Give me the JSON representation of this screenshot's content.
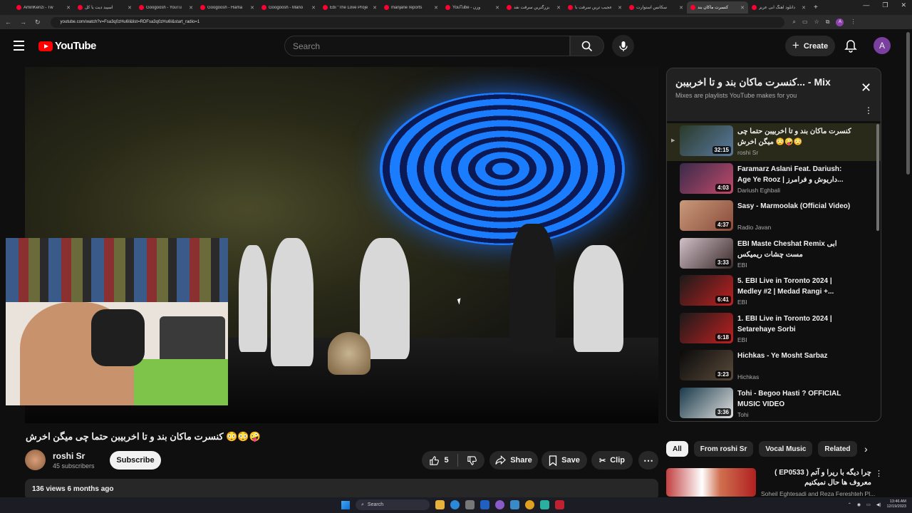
{
  "browser": {
    "tabs": [
      {
        "label": "AminKenzi - Tw"
      },
      {
        "label": "اسپید دیت یا کل"
      },
      {
        "label": "Googoosh - YouTu"
      },
      {
        "label": "Googoosh - Hama"
      },
      {
        "label": "Googoosh - Mano"
      },
      {
        "label": "Ebi \"The Love Proje"
      },
      {
        "label": "manjane reports"
      },
      {
        "label": "YouTube - وزن"
      },
      {
        "label": "بزرگترین سرقت نقد"
      },
      {
        "label": "عجیب ترین سرقت با"
      },
      {
        "label": "سکانس استوارت"
      },
      {
        "label": "کنسرت ماکان بند"
      },
      {
        "label": "دانلود آهنگ ابی عزیز"
      }
    ],
    "url": "youtube.com/watch?v=Fsa3q0zHu6I&list=RDFsa3q0zHu6I&start_radio=1",
    "avatar_letter": "A"
  },
  "header": {
    "logo_text": "YouTube",
    "search_placeholder": "Search",
    "create_label": "Create",
    "avatar_letter": "A"
  },
  "video": {
    "title": "کنسرت ماکان بند و تا اخربیبن حتما چی میگن اخرش 😳😳🤪",
    "channel": "roshi Sr",
    "subscribers": "45 subscribers",
    "subscribe_label": "Subscribe",
    "likes": "5",
    "share_label": "Share",
    "save_label": "Save",
    "clip_label": "Clip",
    "stats": "136 views  6 months ago"
  },
  "playlist": {
    "title": "کنسرت ماکان بند و تا اخربیبن... - Mix",
    "subtitle": "Mixes are playlists YouTube makes for you",
    "items": [
      {
        "index": "▶",
        "title": "کنسرت ماکان بند و تا اخربیبن حتما چی میگن اخرش 😳🤪😳",
        "channel": "roshi Sr",
        "duration": "32:15",
        "c1": "#2a3a2a",
        "c2": "#5a7aa0"
      },
      {
        "index": "",
        "title": "Faramarz Aslani Feat. Dariush: Age Ye Rooz | داریوش و فرامرز...",
        "channel": "Dariush Eghbali",
        "duration": "4:03",
        "c1": "#3a2a4a",
        "c2": "#c04a6a"
      },
      {
        "index": "",
        "title": "Sasy - Marmoolak (Official Video)",
        "channel": "Radio Javan",
        "duration": "4:37",
        "c1": "#c89a7a",
        "c2": "#8a4a3a"
      },
      {
        "index": "",
        "title": "EBI Maste Cheshat Remix ابی مست چشات ریمیکس",
        "channel": "EBI",
        "duration": "3:33",
        "c1": "#d0c0c8",
        "c2": "#3a2a2a"
      },
      {
        "index": "",
        "title": "5. EBI Live in Toronto 2024 | Medley #2 | Medad Rangi +...",
        "channel": "EBI",
        "duration": "6:41",
        "c1": "#1a1a1a",
        "c2": "#c02020"
      },
      {
        "index": "",
        "title": "1. EBI Live in Toronto 2024 | Setarehaye Sorbi",
        "channel": "EBI",
        "duration": "6:18",
        "c1": "#1a1a1a",
        "c2": "#c02020"
      },
      {
        "index": "",
        "title": "Hichkas - Ye Mosht Sarbaz",
        "channel": "Hichkas",
        "duration": "3:23",
        "c1": "#0a0a0a",
        "c2": "#5a4a3a"
      },
      {
        "index": "",
        "title": "Tohi - Begoo Hasti ? OFFICIAL MUSIC VIDEO",
        "channel": "Tohi",
        "duration": "3:36",
        "c1": "#1a3a4a",
        "c2": "#e0e0e0"
      }
    ]
  },
  "chips": [
    {
      "label": "All",
      "selected": true
    },
    {
      "label": "From roshi Sr",
      "selected": false
    },
    {
      "label": "Vocal Music",
      "selected": false
    },
    {
      "label": "Related",
      "selected": false
    }
  ],
  "related": {
    "title": "چرا دیگه با ریرا و آتم ( EP0533 ) معروف ها حال نمیکنیم",
    "channel": "Soheil Eghtesadi and Reza Fereshteh Pl..."
  },
  "taskbar": {
    "search_label": "Search",
    "time": "13:46 AM",
    "date": "12/19/2023"
  }
}
